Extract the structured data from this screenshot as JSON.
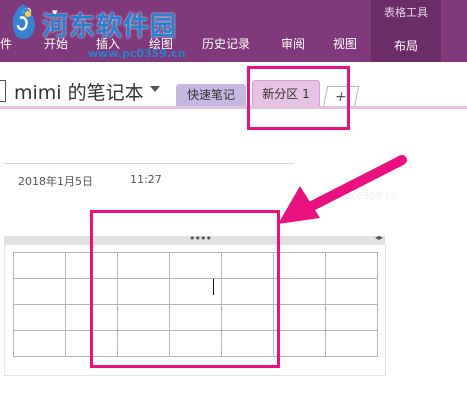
{
  "ribbon": {
    "tabs": [
      {
        "label": "件"
      },
      {
        "label": "开始"
      },
      {
        "label": "插入"
      },
      {
        "label": "绘图"
      },
      {
        "label": "历史记录"
      },
      {
        "label": "审阅"
      },
      {
        "label": "视图"
      }
    ],
    "contextual_group": "表格工具",
    "contextual_tab": "布局",
    "colors": {
      "ribbon": "#80397b",
      "contextual": "#6b2d67"
    }
  },
  "watermark": {
    "text": "河东软件园",
    "url": "www.pc0359.cn"
  },
  "notebook": {
    "title": "mimi 的笔记本",
    "sections": [
      {
        "label": "快速笔记",
        "color": "#c6b8e1"
      },
      {
        "label": "新分区 1",
        "color": "#e5c2e1",
        "active": true
      }
    ],
    "add_section": "+"
  },
  "page": {
    "date": "2018年1月5日",
    "time": "11:27",
    "table": {
      "rows": 4,
      "cols": 7
    }
  },
  "annotation": {
    "color": "#e8117f"
  }
}
